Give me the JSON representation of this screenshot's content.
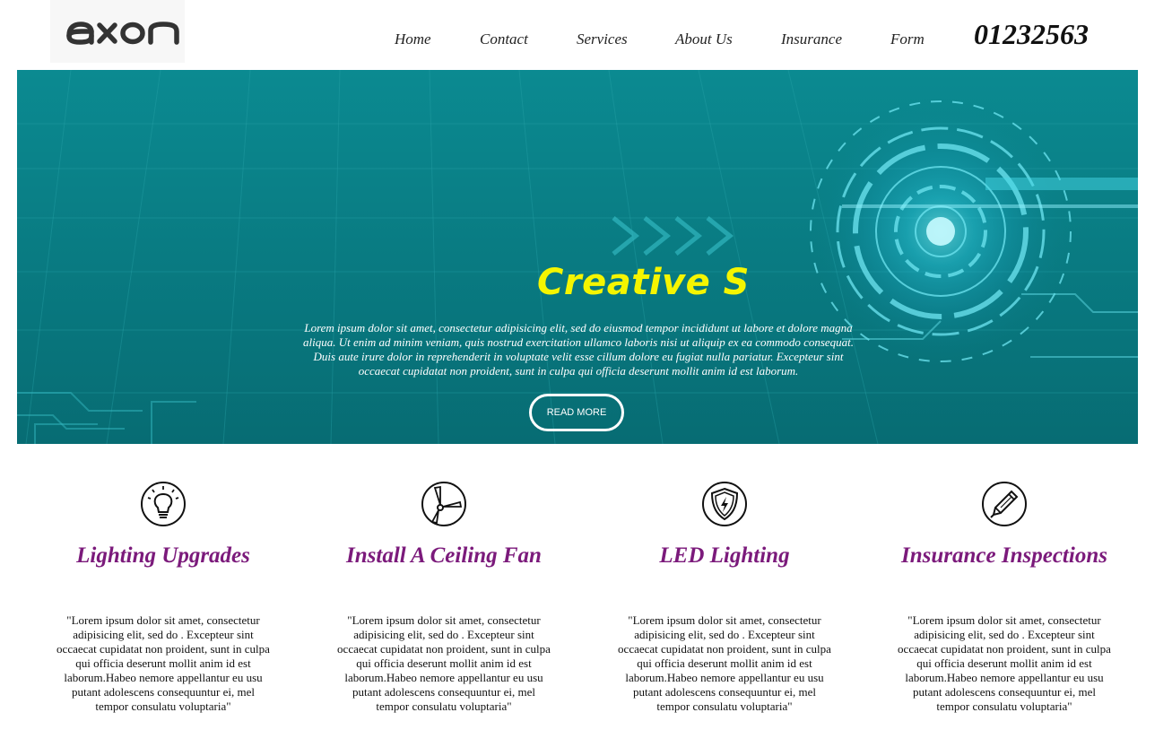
{
  "logo": {
    "text": "axon"
  },
  "nav": {
    "items": [
      {
        "label": "Home"
      },
      {
        "label": "Contact"
      },
      {
        "label": "Services"
      },
      {
        "label": "About Us"
      },
      {
        "label": "Insurance"
      },
      {
        "label": "Form"
      }
    ],
    "phone": "01232563"
  },
  "hero": {
    "title": "Creative S",
    "text": "Lorem ipsum dolor sit amet, consectetur adipisicing elit, sed do eiusmod tempor incididunt ut labore et dolore magna aliqua. Ut enim ad minim veniam, quis nostrud exercitation ullamco laboris nisi ut aliquip ex ea commodo consequat. Duis aute irure dolor in reprehenderit in voluptate velit esse cillum dolore eu fugiat nulla pariatur. Excepteur sint occaecat cupidatat non proident, sunt in culpa qui officia deserunt mollit anim id est laborum.",
    "button_label": "READ MORE",
    "background_color": "#0a7b82",
    "title_color": "#f5f500"
  },
  "features": [
    {
      "icon": "lightbulb-icon",
      "title": "Lighting Upgrades",
      "text": "\"Lorem ipsum dolor sit amet, consectetur adipisicing elit, sed do . Excepteur sint occaecat cupidatat non proident, sunt in culpa qui officia deserunt mollit anim id est laborum.Habeo nemore appellantur eu usu putant adolescens consequuntur ei, mel tempor consulatu voluptaria\""
    },
    {
      "icon": "ceiling-fan-icon",
      "title": "Install A Ceiling Fan",
      "text": "\"Lorem ipsum dolor sit amet, consectetur adipisicing elit, sed do . Excepteur sint occaecat cupidatat non proident, sunt in culpa qui officia deserunt mollit anim id est laborum.Habeo nemore appellantur eu usu putant adolescens consequuntur ei, mel tempor consulatu voluptaria\""
    },
    {
      "icon": "shield-bolt-icon",
      "title": "LED Lighting",
      "text": "\"Lorem ipsum dolor sit amet, consectetur adipisicing elit, sed do . Excepteur sint occaecat cupidatat non proident, sunt in culpa qui officia deserunt mollit anim id est laborum.Habeo nemore appellantur eu usu putant adolescens consequuntur ei, mel tempor consulatu voluptaria\""
    },
    {
      "icon": "pen-icon",
      "title": "Insurance Inspections",
      "text": "\"Lorem ipsum dolor sit amet, consectetur adipisicing elit, sed do . Excepteur sint occaecat cupidatat non proident, sunt in culpa qui officia deserunt mollit anim id est laborum.Habeo nemore appellantur eu usu putant adolescens consequuntur ei, mel tempor consulatu voluptaria\""
    }
  ],
  "colors": {
    "feature_title": "#7b1a7b",
    "nav_text": "#222222"
  }
}
